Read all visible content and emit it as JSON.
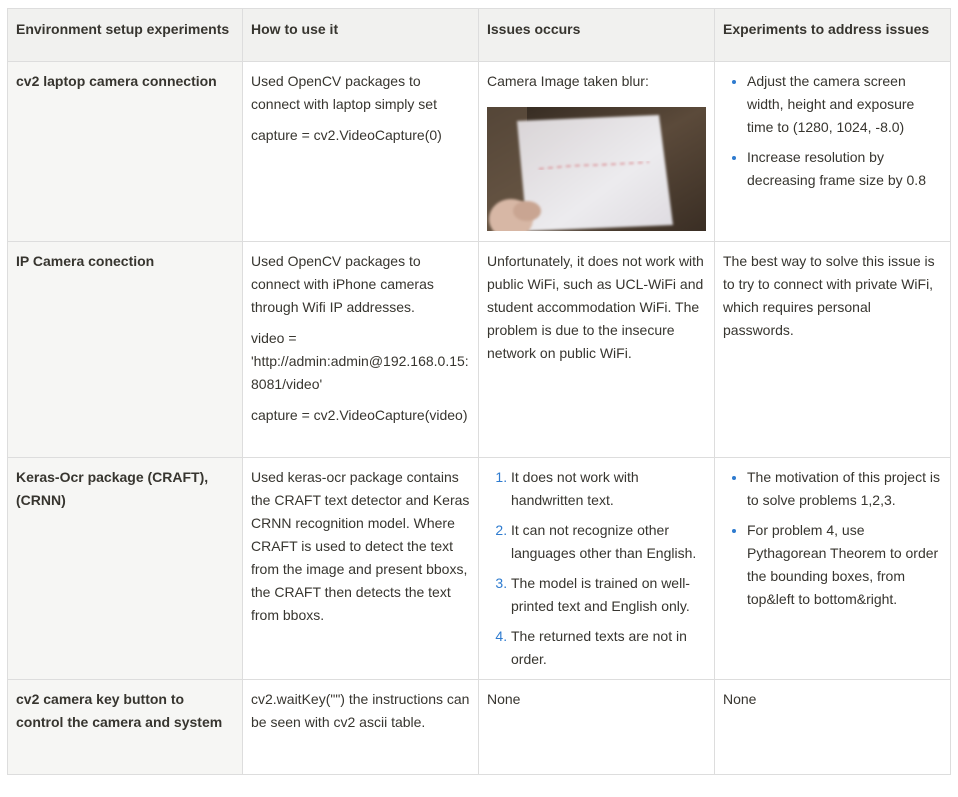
{
  "headers": [
    "Environment setup experiments",
    "How to use it",
    "Issues occurs",
    "Experiments to address issues"
  ],
  "rows": [
    {
      "setup": "cv2 laptop camera connection",
      "how": [
        "Used OpenCV packages to connect with laptop simply set",
        "capture = cv2.VideoCapture(0)"
      ],
      "issues_text": "Camera Image taken blur:",
      "address_bullets": [
        "Adjust the camera screen width, height and exposure time to (1280, 1024, -8.0)",
        "Increase resolution by decreasing frame size by 0.8"
      ]
    },
    {
      "setup": "IP Camera conection",
      "how": [
        "Used OpenCV packages to connect with iPhone cameras through Wifi IP addresses.",
        "video = 'http://admin:admin@192.168.0.15:8081/video'",
        "capture = cv2.VideoCapture(video)"
      ],
      "issues_text": "Unfortunately, it does not work with public WiFi, such as UCL-WiFi and student accommodation WiFi. The problem is due to the insecure network on public WiFi.",
      "address_text": "The best way to solve this issue is to try to connect with private WiFi, which requires personal passwords."
    },
    {
      "setup": "Keras-Ocr package (CRAFT), (CRNN)",
      "how": [
        "Used keras-ocr package contains the CRAFT text detector and Keras CRNN recognition model. Where CRAFT is used to detect the text from the image and present bboxs, the CRAFT then detects the text from bboxs."
      ],
      "issues_list": [
        "It does not work with handwritten text.",
        "It can not recognize other languages other than English.",
        "The model is trained on well-printed text and English only.",
        "The returned texts are not in order."
      ],
      "address_bullets": [
        "The motivation of this project is to solve problems 1,2,3.",
        "For problem 4, use Pythagorean Theorem to order the bounding boxes, from top&left to bottom&right."
      ]
    },
    {
      "setup": "cv2 camera key button to control the camera and system",
      "how": [
        "cv2.waitKey(\"\") the instructions can be seen with cv2 ascii table."
      ],
      "issues_text": "None",
      "address_text": "None"
    }
  ]
}
